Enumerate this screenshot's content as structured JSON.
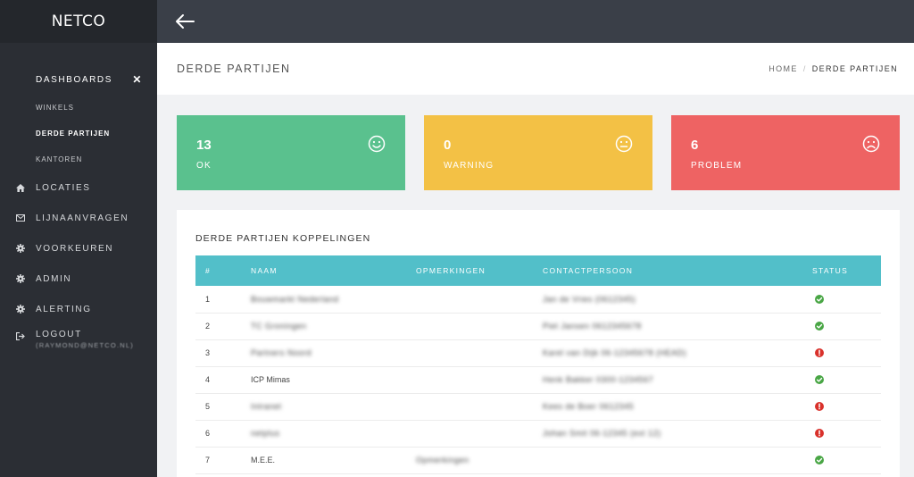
{
  "brand": "NETCO",
  "sidebar": {
    "dashboards_label": "DASHBOARDS",
    "close_glyph": "✕",
    "subitems": [
      "WINKELS",
      "DERDE PARTIJEN",
      "KANTOREN"
    ],
    "items": [
      {
        "label": "LOCATIES",
        "icon": "home-icon"
      },
      {
        "label": "LIJNAANVRAGEN",
        "icon": "envelope-icon"
      },
      {
        "label": "VOORKEUREN",
        "icon": "gear-icon"
      },
      {
        "label": "ADMIN",
        "icon": "gear-icon"
      },
      {
        "label": "ALERTING",
        "icon": "gear-icon"
      }
    ],
    "logout_label": "LOGOUT",
    "logout_email": "(RAYMOND@NETCO.NL)"
  },
  "header": {
    "title": "DERDE PARTIJEN",
    "breadcrumb_home": "HOME",
    "breadcrumb_sep": "/",
    "breadcrumb_current": "DERDE PARTIJEN"
  },
  "stats": {
    "ok": {
      "value": "13",
      "label": "OK"
    },
    "warning": {
      "value": "0",
      "label": "WARNING"
    },
    "problem": {
      "value": "6",
      "label": "PROBLEM"
    }
  },
  "panel": {
    "title": "DERDE PARTIJEN KOPPELINGEN",
    "columns": [
      "#",
      "NAAM",
      "OPMERKINGEN",
      "CONTACTPERSOON",
      "STATUS"
    ],
    "rows": [
      {
        "num": "1",
        "naam": "Bouwmarkt Nederland",
        "opm": "",
        "contact": "Jan de Vries (0612345)",
        "status": "ok"
      },
      {
        "num": "2",
        "naam": "TC Groningen",
        "opm": "",
        "contact": "Piet Jansen 0612345678",
        "status": "ok"
      },
      {
        "num": "3",
        "naam": "Partners Noord",
        "opm": "",
        "contact": "Karel van Dijk 06-12345678 (HEAD)",
        "status": "problem"
      },
      {
        "num": "4",
        "naam": "ICP Mimas",
        "opm": "",
        "contact": "Henk Bakker 0300-1234567",
        "status": "ok"
      },
      {
        "num": "5",
        "naam": "Intranet",
        "opm": "",
        "contact": "Kees de Boer 0612345",
        "status": "problem"
      },
      {
        "num": "6",
        "naam": "netplus",
        "opm": "",
        "contact": "Johan Smit 06-12345 (ext 12)",
        "status": "problem"
      },
      {
        "num": "7",
        "naam": "M.E.E.",
        "opm": "Opmerkingen",
        "contact": "",
        "status": "ok"
      }
    ]
  },
  "colors": {
    "ok": "#5ac18e",
    "warning": "#f3c145",
    "problem": "#ee6363",
    "table_header": "#52bfc9",
    "sidebar": "#2b2e34",
    "topbar": "#3a3f48"
  }
}
